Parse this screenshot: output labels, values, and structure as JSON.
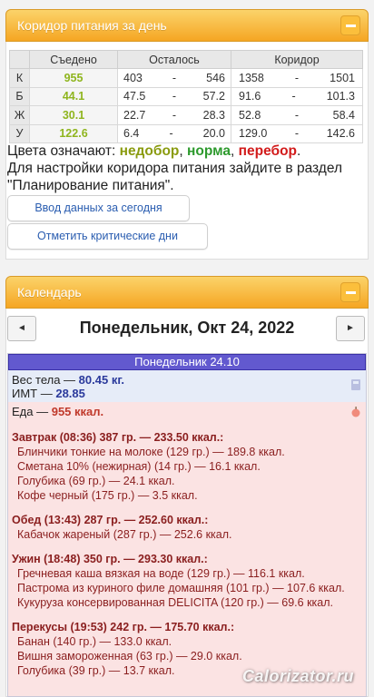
{
  "corridor_panel": {
    "title": "Коридор питания за день",
    "headers": {
      "eaten": "Съедено",
      "remaining": "Осталось",
      "corridor": "Коридор"
    },
    "rows": [
      {
        "label": "К",
        "eaten": "955",
        "rem_from": "403",
        "rem_to": "546",
        "cor_from": "1358",
        "cor_to": "1501"
      },
      {
        "label": "Б",
        "eaten": "44.1",
        "rem_from": "47.5",
        "rem_to": "57.2",
        "cor_from": "91.6",
        "cor_to": "101.3"
      },
      {
        "label": "Ж",
        "eaten": "30.1",
        "rem_from": "22.7",
        "rem_to": "28.3",
        "cor_from": "52.8",
        "cor_to": "58.4"
      },
      {
        "label": "У",
        "eaten": "122.6",
        "rem_from": "6.4",
        "rem_to": "20.0",
        "cor_from": "129.0",
        "cor_to": "142.6"
      }
    ],
    "dash": "-",
    "legend_prefix": "Цвета означают: ",
    "legend_under": "недобор",
    "legend_norm": "норма",
    "legend_over": "перебор",
    "comma": ", ",
    "period": ".",
    "settings_text": "Для настройки коридора питания зайдите в раздел \"Планирование питания\".",
    "btn_input": "Ввод данных за сегодня",
    "btn_critical": "Отметить критические дни"
  },
  "calendar_panel": {
    "title": "Календарь",
    "prev": "◄",
    "next": "►",
    "date": "Понедельник, Окт 24, 2022",
    "day_header": "Понедельник 24.10",
    "weight_label": "Вес тела — ",
    "weight_value": "80.45 кг.",
    "bmi_label": "ИМТ — ",
    "bmi_value": "28.85",
    "food_label": "Еда — ",
    "food_value": "955 ккал.",
    "meals": [
      {
        "title": "Завтрак (08:36) 387 гр. — 233.50 ккал.:",
        "items": [
          "Блинчики тонкие на молоке (129 гр.) — 189.8 ккал.",
          "Сметана 10% (нежирная) (14 гр.) — 16.1 ккал.",
          "Голубика (69 гр.) — 24.1 ккал.",
          "Кофе черный (175 гр.) — 3.5 ккал."
        ]
      },
      {
        "title": "Обед (13:43) 287 гр. — 252.60 ккал.:",
        "items": [
          "Кабачок жареный (287 гр.) — 252.6 ккал."
        ]
      },
      {
        "title": "Ужин (18:48) 350 гр. — 293.30 ккал.:",
        "items": [
          "Гречневая каша вязкая на воде (129 гр.) — 116.1 ккал.",
          "Пастрома из куриного филе домашняя (101 гр.) — 107.6 ккал.",
          "Кукуруза консервированная DELICITA (120 гр.) — 69.6 ккал."
        ]
      },
      {
        "title": "Перекусы (19:53) 242 гр. — 175.70 ккал.:",
        "items": [
          "Банан (140 гр.) — 133.0 ккал.",
          "Вишня замороженная (63 гр.) — 29.0 ккал.",
          "Голубика (39 гр.) — 13.7 ккал."
        ]
      }
    ]
  },
  "watermark": "Calorizator.ru",
  "colors": {
    "panel": "#f5a623",
    "under": "#8a9b0f",
    "norm": "#2d9a2d",
    "over": "#d21b1b",
    "day_header": "#6259cf"
  }
}
